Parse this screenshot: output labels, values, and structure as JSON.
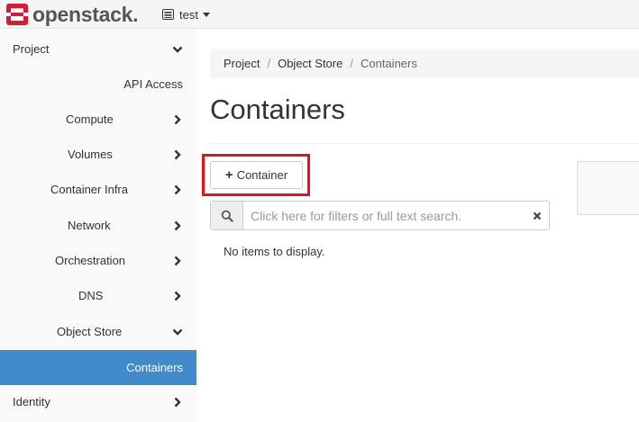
{
  "header": {
    "logo_text": "openstack.",
    "project_name": "test",
    "colors": {
      "logo_red": "#da1a32",
      "bar_bg": "#f5f5f5"
    }
  },
  "sidebar": {
    "items": [
      {
        "label": "Project",
        "chevron": "down",
        "active": false
      },
      {
        "label": "API Access",
        "chevron": "none",
        "active": false
      },
      {
        "label": "Compute",
        "chevron": "right",
        "active": false
      },
      {
        "label": "Volumes",
        "chevron": "right",
        "active": false
      },
      {
        "label": "Container Infra",
        "chevron": "right",
        "active": false
      },
      {
        "label": "Network",
        "chevron": "right",
        "active": false
      },
      {
        "label": "Orchestration",
        "chevron": "right",
        "active": false
      },
      {
        "label": "DNS",
        "chevron": "right",
        "active": false
      },
      {
        "label": "Object Store",
        "chevron": "down",
        "active": false
      },
      {
        "label": "Containers",
        "chevron": "none",
        "active": true
      },
      {
        "label": "Identity",
        "chevron": "right",
        "active": false
      }
    ],
    "colors": {
      "active_bg": "#428bca"
    }
  },
  "breadcrumb": {
    "items": [
      "Project",
      "Object Store",
      "Containers"
    ],
    "separator": "/"
  },
  "page": {
    "title": "Containers",
    "add_button_label": "Container",
    "add_button_icon": "plus-icon",
    "search_placeholder": "Click here for filters or full text search.",
    "search_icon": "search-icon",
    "clear_icon": "close-icon",
    "empty_message": "No items to display.",
    "highlight_color": "#e8101a"
  }
}
